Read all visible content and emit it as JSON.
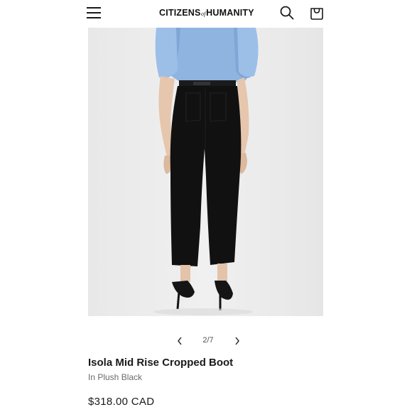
{
  "header": {
    "brand_left": "CITIZENS",
    "brand_of": "of",
    "brand_right": "HUMANITY",
    "icons": {
      "menu": "hamburger-menu-icon",
      "search": "search-icon",
      "cart": "shopping-bag-icon"
    }
  },
  "gallery": {
    "image_description": "product-photo-model-wearing-black-cropped-jeans",
    "counter": "2/7",
    "prev_icon": "chevron-left-icon",
    "next_icon": "chevron-right-icon"
  },
  "product": {
    "title": "Isola Mid Rise Cropped Boot",
    "color": "In Plush Black",
    "price": "$318.00 CAD"
  },
  "colors": {
    "text": "#1a1a1a",
    "muted": "#6b6b6b",
    "image_bg": "#ececec",
    "shirt": "#8fb4e0",
    "jeans": "#111111"
  }
}
